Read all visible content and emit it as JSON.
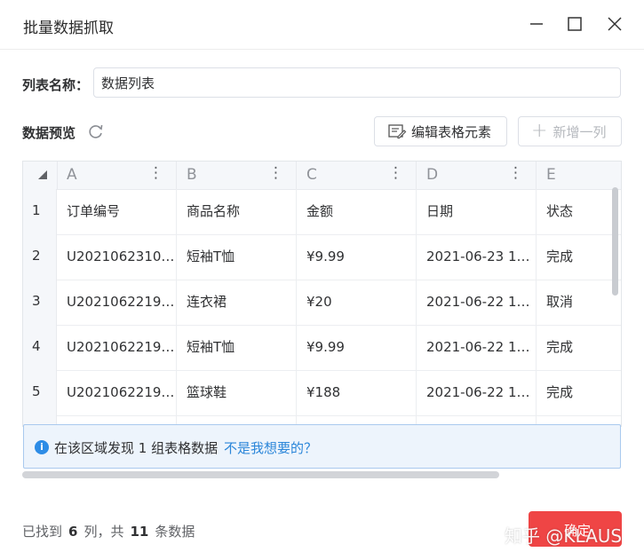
{
  "window": {
    "title": "批量数据抓取"
  },
  "list_name": {
    "label": "列表名称：",
    "value": "数据列表"
  },
  "preview": {
    "label": "数据预览"
  },
  "toolbar": {
    "edit_label": "编辑表格元素",
    "add_label": "新增一列"
  },
  "table": {
    "columns": [
      "A",
      "B",
      "C",
      "D",
      "E"
    ],
    "rows": [
      {
        "num": "1",
        "cells": [
          "订单编号",
          "商品名称",
          "金额",
          "日期",
          "状态"
        ]
      },
      {
        "num": "2",
        "cells": [
          "U2021062310…",
          "短袖T恤",
          "¥9.99",
          "2021-06-23 1…",
          "完成"
        ]
      },
      {
        "num": "3",
        "cells": [
          "U2021062219…",
          "连衣裙",
          "¥20",
          "2021-06-22 1…",
          "取消"
        ]
      },
      {
        "num": "4",
        "cells": [
          "U2021062219…",
          "短袖T恤",
          "¥9.99",
          "2021-06-22 1…",
          "完成"
        ]
      },
      {
        "num": "5",
        "cells": [
          "U2021062219…",
          "篮球鞋",
          "¥188",
          "2021-06-22 1…",
          "完成"
        ]
      }
    ]
  },
  "notice": {
    "message": "在该区域发现 1 组表格数据",
    "link": "不是我想要的？"
  },
  "footer": {
    "found_prefix": "已找到",
    "columns_count": "6",
    "columns_suffix": "列，共",
    "rows_count": "11",
    "rows_suffix": "条数据"
  },
  "confirm_button": {
    "label": "确定"
  },
  "watermark": {
    "text": "知乎 @KLAUS"
  },
  "colors": {
    "accent": "#ef4545",
    "link": "#2b86d9",
    "info": "#2d8ce6"
  }
}
